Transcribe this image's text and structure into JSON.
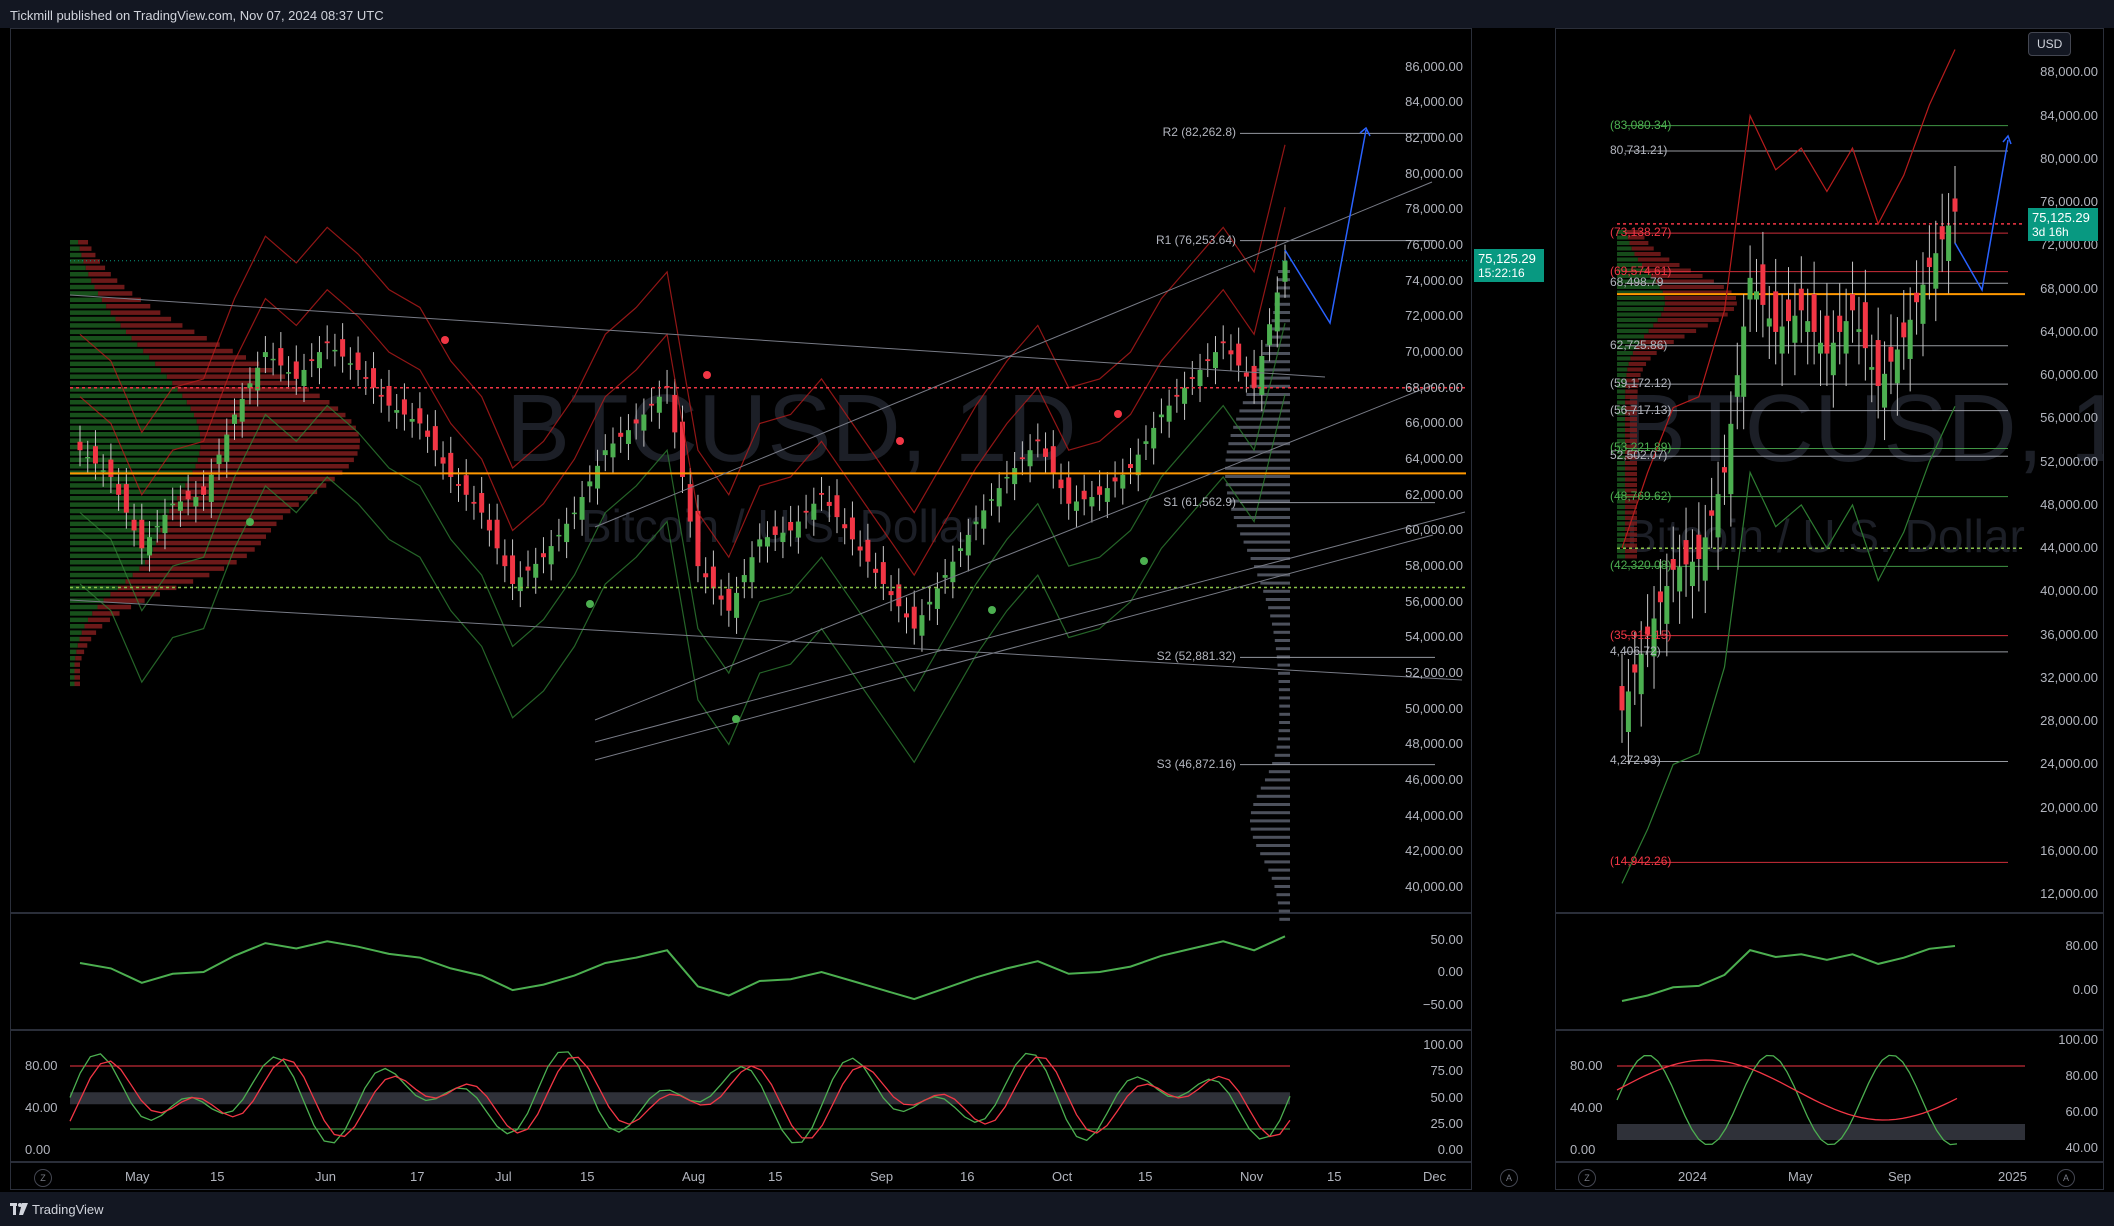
{
  "header": {
    "text": "Tickmill published on TradingView.com, Nov 07, 2024 08:37 UTC"
  },
  "footer": {
    "brand": "TradingView"
  },
  "left_chart": {
    "watermark_symbol": "BTCUSD, 1D",
    "watermark_name": "Bitcoin / U.S. Dollar",
    "price_ticks": [
      "86,000.00",
      "84,000.00",
      "82,000.00",
      "80,000.00",
      "78,000.00",
      "76,000.00",
      "74,000.00",
      "72,000.00",
      "70,000.00",
      "68,000.00",
      "66,000.00",
      "64,000.00",
      "62,000.00",
      "60,000.00",
      "58,000.00",
      "56,000.00",
      "54,000.00",
      "52,000.00",
      "50,000.00",
      "48,000.00",
      "46,000.00",
      "44,000.00",
      "42,000.00",
      "40,000.00"
    ],
    "time_ticks": [
      "May",
      "15",
      "Jun",
      "17",
      "Jul",
      "15",
      "Aug",
      "15",
      "Sep",
      "16",
      "Oct",
      "15",
      "Nov",
      "15",
      "Dec"
    ],
    "pivots": [
      {
        "label": "R2 (82,262.8)",
        "price": 82262.8
      },
      {
        "label": "R1 (76,253.64)",
        "price": 76253.64
      },
      {
        "label": "S1 (61,562.9)",
        "price": 61562.9
      },
      {
        "label": "S2 (52,881.32)",
        "price": 52881.32
      },
      {
        "label": "S3 (46,872.16)",
        "price": 46872.16
      }
    ],
    "last_price": "75,125.29",
    "countdown": "15:22:16",
    "osc1_ticks": [
      "50.00",
      "0.00",
      "−50.00"
    ],
    "osc2_ticks_left": [
      "80.00",
      "40.00",
      "0.00"
    ],
    "osc2_ticks_right": [
      "100.00",
      "75.00",
      "50.00",
      "25.00",
      "0.00"
    ]
  },
  "right_chart": {
    "watermark_symbol": "BTCUSD, 1W",
    "watermark_name": "Bitcoin / U.S. Dollar",
    "currency": "USD",
    "price_ticks": [
      "88,000.00",
      "84,000.00",
      "80,000.00",
      "76,000.00",
      "72,000.00",
      "68,000.00",
      "64,000.00",
      "60,000.00",
      "56,000.00",
      "52,000.00",
      "48,000.00",
      "44,000.00",
      "40,000.00",
      "36,000.00",
      "32,000.00",
      "28,000.00",
      "24,000.00",
      "20,000.00",
      "16,000.00",
      "12,000.00"
    ],
    "time_ticks": [
      "2024",
      "May",
      "Sep",
      "2025"
    ],
    "levels": [
      {
        "label": "(83,080.34)",
        "price": 83080.34,
        "color": "#4caf50"
      },
      {
        "label": "80,731.21)",
        "price": 80731.21,
        "color": "#b2b5be"
      },
      {
        "label": "(73,138.27)",
        "price": 73138.27,
        "color": "#f23645"
      },
      {
        "label": "(69,574.61)",
        "price": 69574.61,
        "color": "#f23645"
      },
      {
        "label": "68,498.79",
        "price": 68498.79,
        "color": "#b2b5be"
      },
      {
        "label": "62,725.86)",
        "price": 62725.86,
        "color": "#b2b5be"
      },
      {
        "label": "(59,172.12)",
        "price": 59172.12,
        "color": "#b2b5be"
      },
      {
        "label": "(56,717.13)",
        "price": 56717.13,
        "color": "#b2b5be"
      },
      {
        "label": "(53,221.89)",
        "price": 53221.89,
        "color": "#4caf50"
      },
      {
        "label": "52,502.07)",
        "price": 52502.07,
        "color": "#b2b5be"
      },
      {
        "label": "(48,769.62)",
        "price": 48769.62,
        "color": "#4caf50"
      },
      {
        "label": "(42,320.08)",
        "price": 42320.08,
        "color": "#4caf50"
      },
      {
        "label": "(35,912.15)",
        "price": 35912.15,
        "color": "#f23645"
      },
      {
        "label": "4,406.72)",
        "price": 34406.72,
        "color": "#b2b5be"
      },
      {
        "label": "4,272.93)",
        "price": 24272.93,
        "color": "#b2b5be"
      },
      {
        "label": "(14,942.26)",
        "price": 14942.26,
        "color": "#f23645"
      }
    ],
    "last_price": "75,125.29",
    "countdown": "3d 16h",
    "osc1_ticks": [
      "80.00",
      "0.00"
    ],
    "osc2_ticks_left": [
      "80.00",
      "40.00",
      "0.00"
    ],
    "osc2_ticks_right": [
      "100.00",
      "80.00",
      "60.00",
      "40.00"
    ]
  },
  "colors": {
    "up": "#089981",
    "down": "#f23645",
    "poc": "#ff9800",
    "accent": "#2962ff"
  },
  "chart_data": [
    {
      "type": "candlestick",
      "title": "BTCUSD, 1D",
      "subtitle": "Bitcoin / U.S. Dollar",
      "ylim": [
        39000,
        87500
      ],
      "x": [
        "Apr 26",
        "May 1",
        "May 6",
        "May 11",
        "May 16",
        "May 21",
        "May 26",
        "May 31",
        "Jun 5",
        "Jun 10",
        "Jun 15",
        "Jun 20",
        "Jun 25",
        "Jun 30",
        "Jul 5",
        "Jul 10",
        "Jul 15",
        "Jul 20",
        "Jul 25",
        "Jul 30",
        "Aug 4",
        "Aug 9",
        "Aug 14",
        "Aug 19",
        "Aug 24",
        "Aug 29",
        "Sep 3",
        "Sep 8",
        "Sep 13",
        "Sep 18",
        "Sep 23",
        "Sep 28",
        "Oct 3",
        "Oct 8",
        "Oct 13",
        "Oct 18",
        "Oct 23",
        "Oct 28",
        "Nov 2",
        "Nov 6"
      ],
      "close": [
        64500,
        63000,
        59000,
        61500,
        62000,
        66500,
        70000,
        68500,
        70500,
        69000,
        67000,
        66000,
        63000,
        61000,
        57000,
        58500,
        61000,
        64500,
        66000,
        68000,
        58000,
        55500,
        59500,
        60000,
        62000,
        59500,
        57000,
        54500,
        57500,
        60500,
        63000,
        65000,
        61500,
        62000,
        63500,
        66500,
        68500,
        70500,
        68000,
        75125
      ],
      "xlabel": "",
      "ylabel": ""
    },
    {
      "type": "candlestick",
      "title": "BTCUSD, 1W",
      "subtitle": "Bitcoin / U.S. Dollar",
      "ylim": [
        11000,
        91000
      ],
      "x": [
        "Oct 2023",
        "Nov 2023",
        "Dec 2023",
        "Jan 2024",
        "Feb 2024",
        "Mar 2024",
        "Apr 2024",
        "May 2024",
        "Jun 2024",
        "Jul 2024",
        "Aug 2024",
        "Sep 2024",
        "Oct 2024",
        "Nov 2024"
      ],
      "close": [
        29000,
        36000,
        42000,
        43000,
        51000,
        69000,
        64000,
        66000,
        62000,
        66000,
        59000,
        63500,
        70000,
        75125
      ],
      "xlabel": "",
      "ylabel": ""
    }
  ]
}
